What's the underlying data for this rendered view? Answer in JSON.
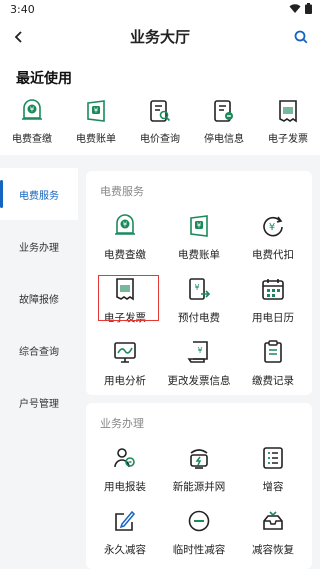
{
  "status": {
    "time": "3:40"
  },
  "header": {
    "title": "业务大厅"
  },
  "recent": {
    "title": "最近使用",
    "items": [
      {
        "label": "电费查缴",
        "icon": "bill-pay-icon"
      },
      {
        "label": "电费账单",
        "icon": "bill-icon"
      },
      {
        "label": "电价查询",
        "icon": "price-search-icon"
      },
      {
        "label": "停电信息",
        "icon": "outage-info-icon"
      },
      {
        "label": "电子发票",
        "icon": "e-invoice-icon"
      }
    ]
  },
  "sidebar": {
    "items": [
      {
        "label": "电费服务",
        "active": true
      },
      {
        "label": "业务办理"
      },
      {
        "label": "故障报修"
      },
      {
        "label": "综合查询"
      },
      {
        "label": "户号管理"
      }
    ]
  },
  "sections": [
    {
      "title": "电费服务",
      "items": [
        {
          "label": "电费查缴",
          "icon": "bill-pay-icon"
        },
        {
          "label": "电费账单",
          "icon": "bill-icon"
        },
        {
          "label": "电费代扣",
          "icon": "auto-debit-icon"
        },
        {
          "label": "电子发票",
          "icon": "e-invoice-icon"
        },
        {
          "label": "预付电费",
          "icon": "prepay-icon"
        },
        {
          "label": "用电日历",
          "icon": "calendar-icon"
        },
        {
          "label": "用电分析",
          "icon": "analysis-icon"
        },
        {
          "label": "更改发票信息",
          "icon": "invoice-edit-icon"
        },
        {
          "label": "缴费记录",
          "icon": "payment-record-icon"
        }
      ]
    },
    {
      "title": "业务办理",
      "items": [
        {
          "label": "用电报装",
          "icon": "install-icon"
        },
        {
          "label": "新能源并网",
          "icon": "new-energy-icon"
        },
        {
          "label": "增容",
          "icon": "capacity-increase-icon"
        },
        {
          "label": "永久减容",
          "icon": "permanent-reduce-icon"
        },
        {
          "label": "临时性减容",
          "icon": "temp-reduce-icon"
        },
        {
          "label": "减容恢复",
          "icon": "reduce-restore-icon"
        }
      ]
    }
  ],
  "colors": {
    "accent": "#1565c0",
    "icon_green": "#1a8a5a",
    "highlight": "#e53935"
  }
}
